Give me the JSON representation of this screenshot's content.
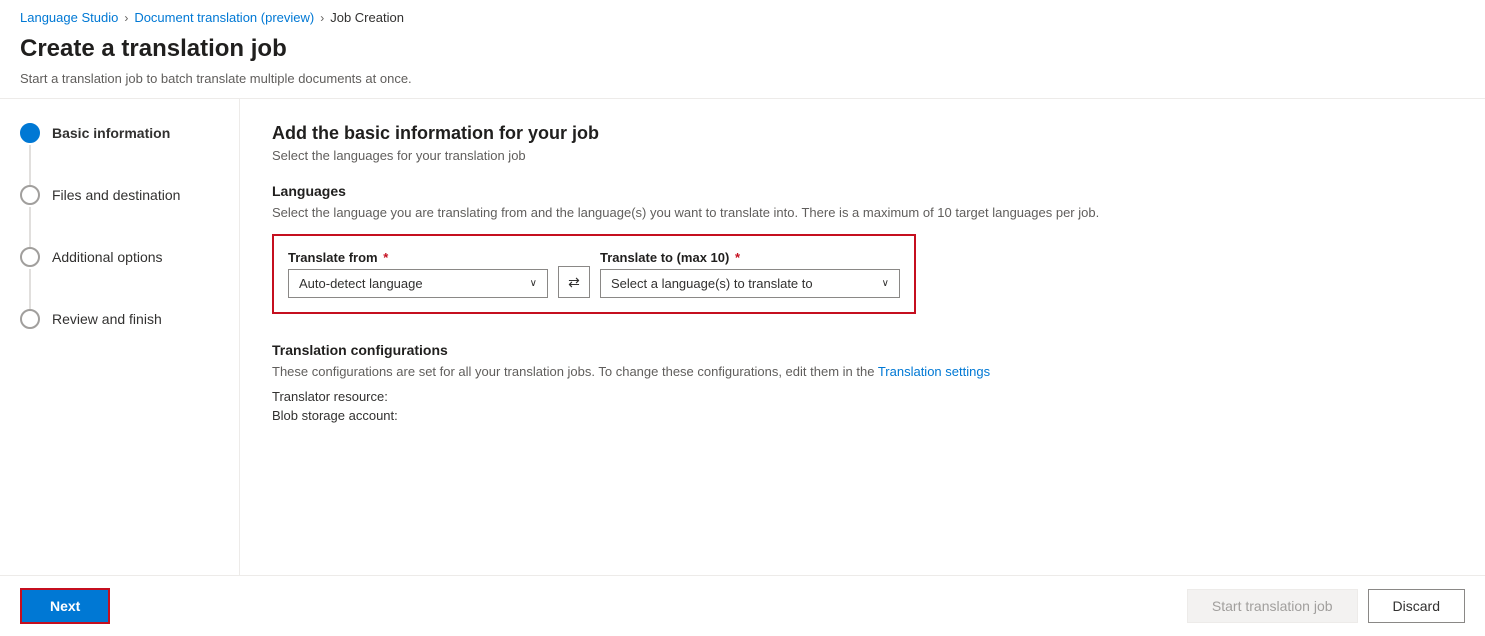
{
  "breadcrumb": {
    "items": [
      {
        "label": "Language Studio",
        "href": "#"
      },
      {
        "label": "Document translation (preview)",
        "href": "#"
      },
      {
        "label": "Job Creation"
      }
    ]
  },
  "page": {
    "title": "Create a translation job",
    "subtitle": "Start a translation job to batch translate multiple documents at once."
  },
  "sidebar": {
    "steps": [
      {
        "label": "Basic information",
        "active": true
      },
      {
        "label": "Files and destination",
        "active": false
      },
      {
        "label": "Additional options",
        "active": false
      },
      {
        "label": "Review and finish",
        "active": false
      }
    ]
  },
  "content": {
    "section_title": "Add the basic information for your job",
    "section_subtitle": "Select the languages for your translation job",
    "languages_heading": "Languages",
    "languages_description": "Select the language you are translating from and the language(s) you want to translate into. There is a maximum of 10 target languages per job.",
    "translate_from_label": "Translate from",
    "translate_from_placeholder": "Auto-detect language",
    "translate_to_label": "Translate to (max 10)",
    "translate_to_placeholder": "Select a language(s) to translate to",
    "configs_heading": "Translation configurations",
    "configs_description_prefix": "These configurations are set for all your translation jobs. To change these configurations, edit them in the ",
    "configs_link_text": "Translation settings",
    "translator_resource_label": "Translator resource:",
    "blob_storage_label": "Blob storage account:"
  },
  "footer": {
    "next_label": "Next",
    "start_translation_label": "Start translation job",
    "discard_label": "Discard"
  },
  "icons": {
    "chevron_right": "›",
    "chevron_down": "˅",
    "swap": "⇄"
  }
}
